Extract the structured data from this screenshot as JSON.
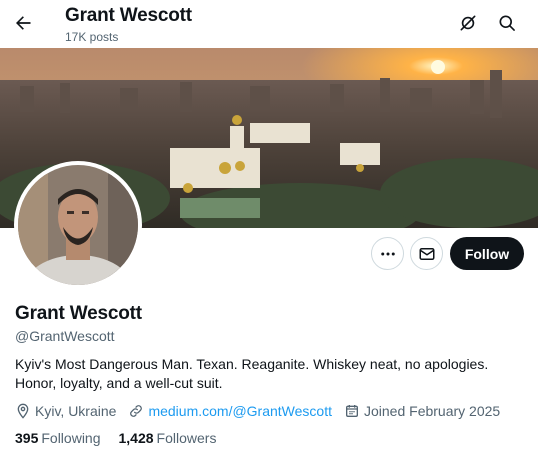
{
  "header": {
    "title": "Grant Wescott",
    "subtitle": "17K posts",
    "back_icon": "arrow-left-icon",
    "icons": [
      "grok-icon",
      "search-icon"
    ]
  },
  "banner": {
    "description_icon": "cityscape-sunset-image"
  },
  "profile": {
    "name": "Grant Wescott",
    "handle": "@GrantWescott",
    "bio": "Kyiv's Most Dangerous Man. Texan. Reaganite. Whiskey neat, no apologies. Honor, loyalty, and a well-cut suit.",
    "location": "Kyiv, Ukraine",
    "website": "medium.com/@GrantWescott",
    "joined": "Joined February 2025"
  },
  "actions": {
    "follow_label": "Follow",
    "more_icon": "more-icon",
    "message_icon": "mail-icon"
  },
  "stats": {
    "following_count": "395",
    "following_label": "Following",
    "followers_count": "1,428",
    "followers_label": "Followers"
  },
  "colors": {
    "text": "#0f1419",
    "muted": "#536471",
    "link": "#1d9bf0",
    "button_dark": "#0f1419",
    "border": "#cfd9de"
  }
}
